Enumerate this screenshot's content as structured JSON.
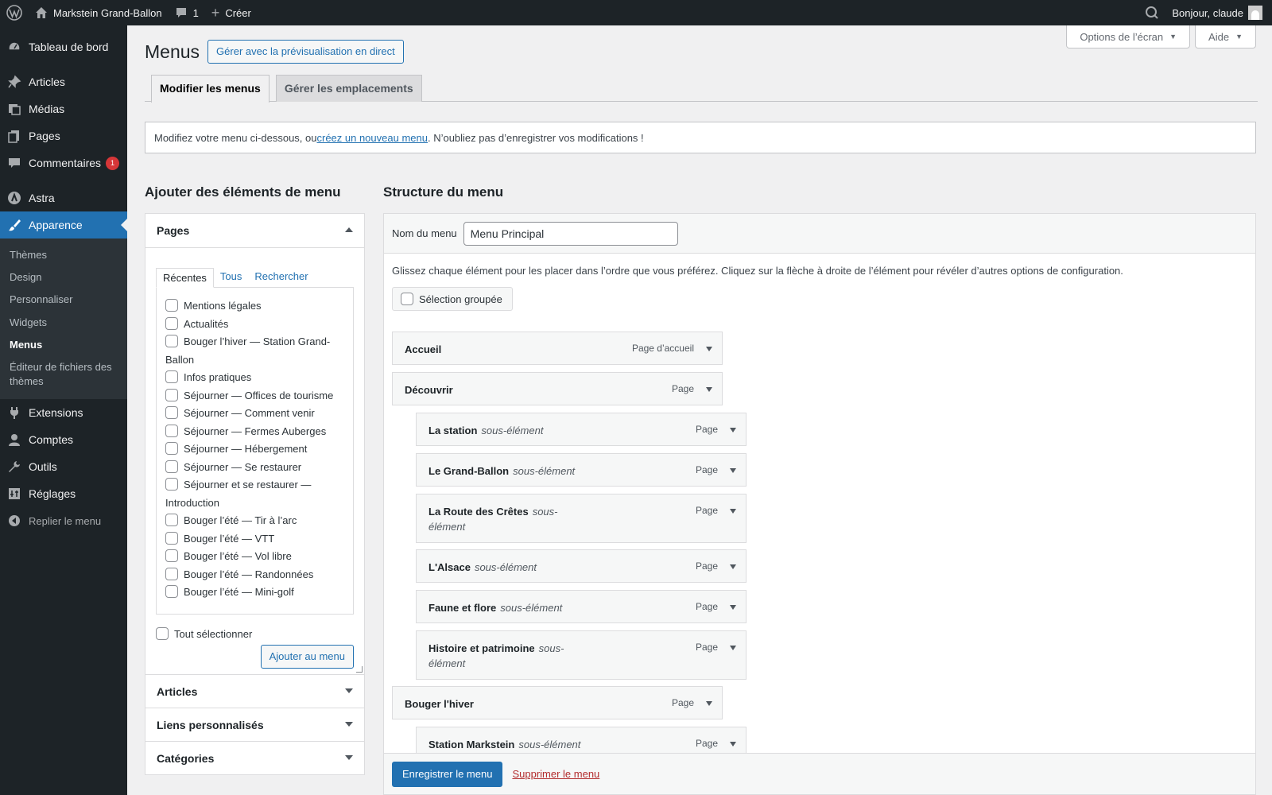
{
  "adminbar": {
    "site_name": "Markstein Grand-Ballon",
    "comments_count": "1",
    "new_label": "Créer",
    "greeting": "Bonjour, claude"
  },
  "sidebar": {
    "dashboard": "Tableau de bord",
    "posts": "Articles",
    "media": "Médias",
    "pages": "Pages",
    "comments": "Commentaires",
    "comments_badge": "1",
    "astra": "Astra",
    "appearance": "Apparence",
    "appearance_submenu": [
      "Thèmes",
      "Design",
      "Personnaliser",
      "Widgets",
      "Menus",
      "Éditeur de fichiers des thèmes"
    ],
    "plugins": "Extensions",
    "users": "Comptes",
    "tools": "Outils",
    "settings": "Réglages",
    "collapse": "Replier le menu"
  },
  "screen_meta": {
    "options": "Options de l’écran",
    "help": "Aide"
  },
  "page": {
    "title": "Menus",
    "live_preview_button": "Gérer avec la prévisualisation en direct",
    "tabs": [
      "Modifier les menus",
      "Gérer les emplacements"
    ],
    "notice_before": "Modifiez votre menu ci-dessous, ou ",
    "notice_link": "créez un nouveau menu",
    "notice_after": ". N’oubliez pas d’enregistrer vos modifications !"
  },
  "add_items": {
    "heading": "Ajouter des éléments de menu",
    "pages_title": "Pages",
    "inner_tabs": [
      "Récentes",
      "Tous",
      "Rechercher"
    ],
    "page_list": [
      "Mentions légales",
      "Actualités",
      "Bouger l’hiver — Station Grand-Ballon",
      "Infos pratiques",
      "Séjourner — Offices de tourisme",
      "Séjourner — Comment venir",
      "Séjourner — Fermes Auberges",
      "Séjourner — Hébergement",
      "Séjourner — Se restaurer",
      "Séjourner et se restaurer — Introduction",
      "Bouger l’été — Tir à l’arc",
      "Bouger l’été — VTT",
      "Bouger l’été — Vol libre",
      "Bouger l’été — Randonnées",
      "Bouger l’été — Mini-golf"
    ],
    "select_all": "Tout sélectionner",
    "add_button": "Ajouter au menu",
    "other_sections": [
      "Articles",
      "Liens personnalisés",
      "Catégories"
    ]
  },
  "structure": {
    "heading": "Structure du menu",
    "name_label": "Nom du menu",
    "name_value": "Menu Principal",
    "instructions": "Glissez chaque élément pour les placer dans l’ordre que vous préférez. Cliquez sur la flèche à droite de l’élément pour révéler d’autres options de configuration.",
    "bulk_select": "Sélection groupée",
    "sub_label": "sous-élément",
    "items": [
      {
        "title": "Accueil",
        "type": "Page d’accueil",
        "sub": false
      },
      {
        "title": "Découvrir",
        "type": "Page",
        "sub": false
      },
      {
        "title": "La station",
        "type": "Page",
        "sub": true
      },
      {
        "title": "Le Grand-Ballon",
        "type": "Page",
        "sub": true
      },
      {
        "title": "La Route des Crêtes",
        "type": "Page",
        "sub": true
      },
      {
        "title": "L'Alsace",
        "type": "Page",
        "sub": true
      },
      {
        "title": "Faune et flore",
        "type": "Page",
        "sub": true
      },
      {
        "title": "Histoire et patrimoine",
        "type": "Page",
        "sub": true
      },
      {
        "title": "Bouger l'hiver",
        "type": "Page",
        "sub": false
      },
      {
        "title": "Station Markstein",
        "type": "Page",
        "sub": true
      }
    ],
    "save_button": "Enregistrer le menu",
    "delete_link": "Supprimer le menu"
  },
  "colors": {
    "accent": "#2271b1",
    "admin_bg": "#1d2327",
    "danger": "#d63638"
  }
}
